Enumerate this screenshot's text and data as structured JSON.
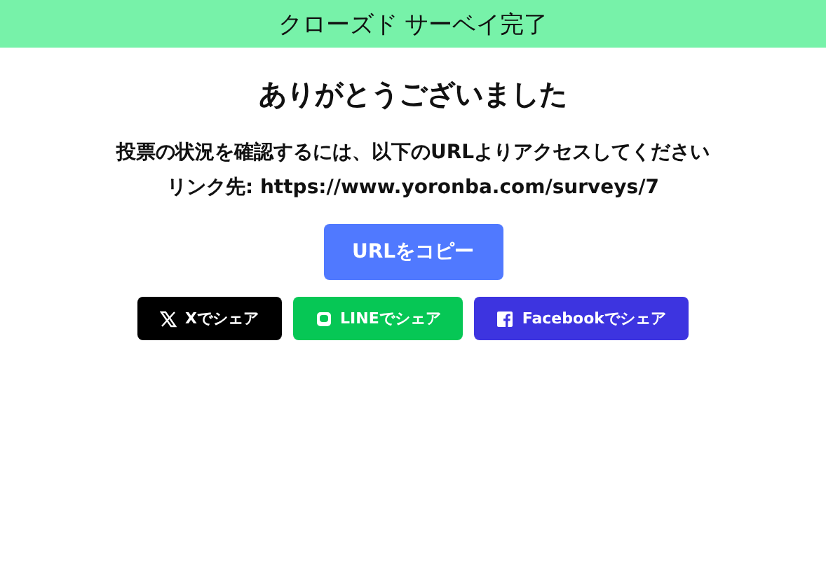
{
  "header": {
    "title": "クローズド サーベイ完了"
  },
  "heading": "ありがとうございました",
  "message": "投票の状況を確認するには、以下のURLよりアクセスしてください",
  "link_line": "リンク先: https://www.yoronba.com/surveys/7",
  "copy_button": "URLをコピー",
  "share_buttons": [
    {
      "kind": "x",
      "label": "Xでシェア",
      "color": "#000000"
    },
    {
      "kind": "line",
      "label": "LINEでシェア",
      "color": "#06c755"
    },
    {
      "kind": "facebook",
      "label": "Facebookでシェア",
      "color": "#3d34e0"
    }
  ]
}
